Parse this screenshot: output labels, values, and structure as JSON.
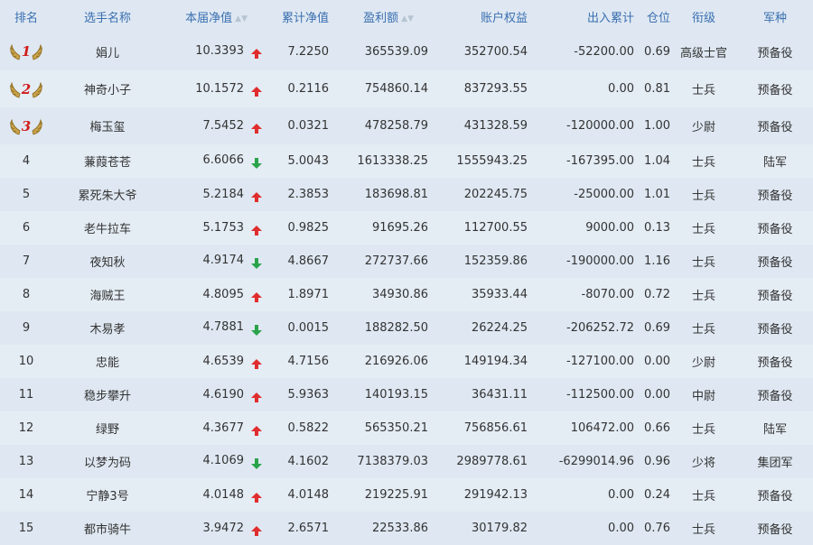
{
  "colors": {
    "up": "#e02d2d",
    "down": "#2aa34a",
    "header": "#3a6fb0",
    "medal": "#c8a24a"
  },
  "headers": {
    "rank": "排名",
    "name": "选手名称",
    "nav": "本届净值",
    "cum_nav": "累计净值",
    "profit": "盈利额",
    "equity": "账户权益",
    "flow": "出入累计",
    "position": "仓位",
    "grade": "衔级",
    "army": "军种"
  },
  "rows": [
    {
      "rank": "1",
      "name": "娟儿",
      "nav": "10.3393",
      "dir": "up",
      "cum_nav": "7.2250",
      "profit": "365539.09",
      "equity": "352700.54",
      "flow": "-52200.00",
      "pos": "0.69",
      "grade": "高级士官",
      "army": "预备役"
    },
    {
      "rank": "2",
      "name": "神奇小子",
      "nav": "10.1572",
      "dir": "up",
      "cum_nav": "0.2116",
      "profit": "754860.14",
      "equity": "837293.55",
      "flow": "0.00",
      "pos": "0.81",
      "grade": "士兵",
      "army": "预备役"
    },
    {
      "rank": "3",
      "name": "梅玉玺",
      "nav": "7.5452",
      "dir": "up",
      "cum_nav": "0.0321",
      "profit": "478258.79",
      "equity": "431328.59",
      "flow": "-120000.00",
      "pos": "1.00",
      "grade": "少尉",
      "army": "预备役"
    },
    {
      "rank": "4",
      "name": "蒹葭苍苍",
      "nav": "6.6066",
      "dir": "down",
      "cum_nav": "5.0043",
      "profit": "1613338.25",
      "equity": "1555943.25",
      "flow": "-167395.00",
      "pos": "1.04",
      "grade": "士兵",
      "army": "陆军"
    },
    {
      "rank": "5",
      "name": "累死朱大爷",
      "nav": "5.2184",
      "dir": "up",
      "cum_nav": "2.3853",
      "profit": "183698.81",
      "equity": "202245.75",
      "flow": "-25000.00",
      "pos": "1.01",
      "grade": "士兵",
      "army": "预备役"
    },
    {
      "rank": "6",
      "name": "老牛拉车",
      "nav": "5.1753",
      "dir": "up",
      "cum_nav": "0.9825",
      "profit": "91695.26",
      "equity": "112700.55",
      "flow": "9000.00",
      "pos": "0.13",
      "grade": "士兵",
      "army": "预备役"
    },
    {
      "rank": "7",
      "name": "夜知秋",
      "nav": "4.9174",
      "dir": "down",
      "cum_nav": "4.8667",
      "profit": "272737.66",
      "equity": "152359.86",
      "flow": "-190000.00",
      "pos": "1.16",
      "grade": "士兵",
      "army": "预备役"
    },
    {
      "rank": "8",
      "name": "海贼王",
      "nav": "4.8095",
      "dir": "up",
      "cum_nav": "1.8971",
      "profit": "34930.86",
      "equity": "35933.44",
      "flow": "-8070.00",
      "pos": "0.72",
      "grade": "士兵",
      "army": "预备役"
    },
    {
      "rank": "9",
      "name": "木易孝",
      "nav": "4.7881",
      "dir": "down",
      "cum_nav": "0.0015",
      "profit": "188282.50",
      "equity": "26224.25",
      "flow": "-206252.72",
      "pos": "0.69",
      "grade": "士兵",
      "army": "预备役"
    },
    {
      "rank": "10",
      "name": "忠能",
      "nav": "4.6539",
      "dir": "up",
      "cum_nav": "4.7156",
      "profit": "216926.06",
      "equity": "149194.34",
      "flow": "-127100.00",
      "pos": "0.00",
      "grade": "少尉",
      "army": "预备役"
    },
    {
      "rank": "11",
      "name": "稳步攀升",
      "nav": "4.6190",
      "dir": "up",
      "cum_nav": "5.9363",
      "profit": "140193.15",
      "equity": "36431.11",
      "flow": "-112500.00",
      "pos": "0.00",
      "grade": "中尉",
      "army": "预备役"
    },
    {
      "rank": "12",
      "name": "绿野",
      "nav": "4.3677",
      "dir": "up",
      "cum_nav": "0.5822",
      "profit": "565350.21",
      "equity": "756856.61",
      "flow": "106472.00",
      "pos": "0.66",
      "grade": "士兵",
      "army": "陆军"
    },
    {
      "rank": "13",
      "name": "以梦为码",
      "nav": "4.1069",
      "dir": "down",
      "cum_nav": "4.1602",
      "profit": "7138379.03",
      "equity": "2989778.61",
      "flow": "-6299014.96",
      "pos": "0.96",
      "grade": "少将",
      "army": "集团军"
    },
    {
      "rank": "14",
      "name": "宁静3号",
      "nav": "4.0148",
      "dir": "up",
      "cum_nav": "4.0148",
      "profit": "219225.91",
      "equity": "291942.13",
      "flow": "0.00",
      "pos": "0.24",
      "grade": "士兵",
      "army": "预备役"
    },
    {
      "rank": "15",
      "name": "都市骑牛",
      "nav": "3.9472",
      "dir": "up",
      "cum_nav": "2.6571",
      "profit": "22533.86",
      "equity": "30179.82",
      "flow": "0.00",
      "pos": "0.76",
      "grade": "士兵",
      "army": "预备役"
    }
  ]
}
